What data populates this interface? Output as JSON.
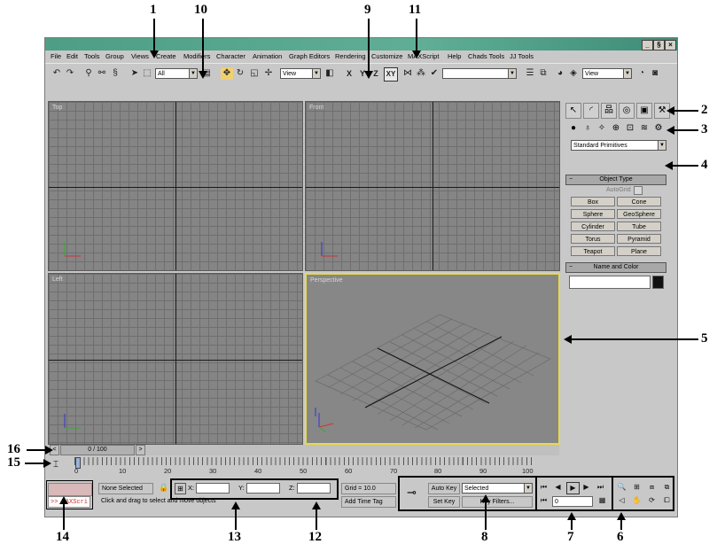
{
  "callouts": [
    "1",
    "10",
    "9",
    "11",
    "2",
    "3",
    "4",
    "5",
    "6",
    "7",
    "8",
    "12",
    "13",
    "14",
    "15",
    "16"
  ],
  "titlebar": {
    "min": "_",
    "max": "§",
    "close": "×"
  },
  "menu": [
    "File",
    "Edit",
    "Tools",
    "Group",
    "Views",
    "Create",
    "Modifiers",
    "Character",
    "Animation",
    "Graph Editors",
    "Rendering",
    "Customize",
    "MAXScript",
    "Help",
    "Chads Tools",
    "JJ Tools"
  ],
  "toolbar": {
    "selection_filter": "All",
    "refcoord": "View",
    "x": "X",
    "y": "Y",
    "z": "Z",
    "xy": "XY",
    "named_sel": "",
    "render_view": "View"
  },
  "viewports": {
    "top": "Top",
    "front": "Front",
    "left": "Left",
    "perspective": "Perspective"
  },
  "command_panel": {
    "category": "Standard Primitives",
    "object_type": "Object Type",
    "autogrid": "AutoGrid",
    "buttons": [
      "Box",
      "Cone",
      "Sphere",
      "GeoSphere",
      "Cylinder",
      "Tube",
      "Torus",
      "Pyramid",
      "Teapot",
      "Plane"
    ],
    "name_color": "Name and Color"
  },
  "time_slider": {
    "label": "0 / 100",
    "prev": "<",
    "next": ">"
  },
  "track_ticks": [
    "0",
    "10",
    "20",
    "30",
    "40",
    "50",
    "60",
    "70",
    "80",
    "90",
    "100"
  ],
  "status": {
    "maxscript": ">> MAXScri",
    "selection": "None Selected",
    "prompt": "Click and drag to select and move objects",
    "x_label": "X:",
    "y_label": "Y:",
    "z_label": "Z:",
    "grid": "Grid = 10.0",
    "time_tag": "Add Time Tag",
    "auto_key": "Auto Key",
    "set_key": "Set Key",
    "key_mode": "Selected",
    "key_filters": "Key Filters...",
    "frame": "0"
  }
}
